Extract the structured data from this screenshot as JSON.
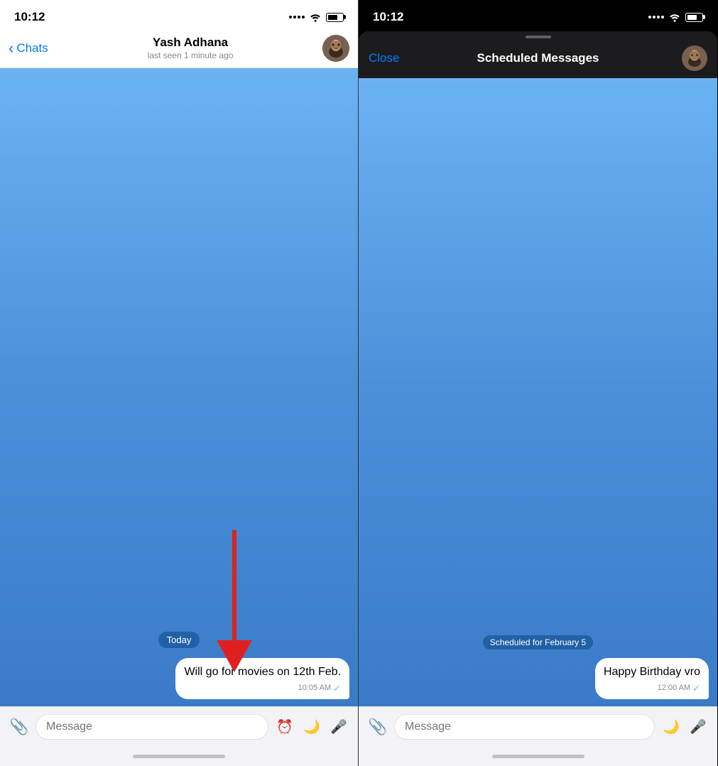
{
  "left_panel": {
    "status_bar": {
      "time": "10:12"
    },
    "nav": {
      "back_label": "Chats",
      "contact_name": "Yash Adhana",
      "last_seen": "last seen 1 minute ago"
    },
    "messages": [
      {
        "id": "msg1",
        "text": "Will go for movies on 12th Feb.",
        "time": "10:05 AM",
        "direction": "outgoing",
        "checked": true
      }
    ],
    "date_badge": "Today",
    "input_placeholder": "Message"
  },
  "right_panel": {
    "status_bar": {
      "time": "10:12"
    },
    "modal": {
      "close_label": "Close",
      "title": "Scheduled Messages"
    },
    "scheduled_for": "Scheduled for February 5",
    "messages": [
      {
        "id": "smsg1",
        "text": "Happy Birthday vro",
        "time": "12:00 AM",
        "direction": "outgoing",
        "checked": true
      }
    ],
    "input_placeholder": "Message"
  },
  "icons": {
    "clip": "📎",
    "schedule": "⏰",
    "moon": "🌙",
    "mic": "🎤",
    "wifi": "wifi",
    "battery": "battery"
  }
}
